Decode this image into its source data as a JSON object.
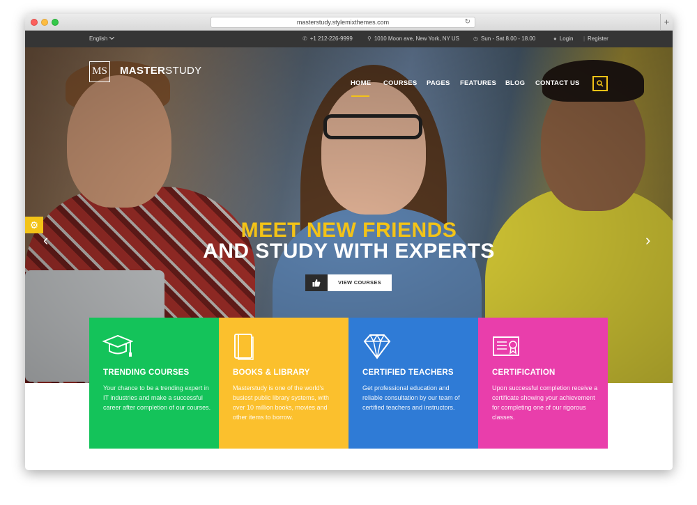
{
  "browser": {
    "url": "masterstudy.stylemixthemes.com",
    "new_tab_label": "+"
  },
  "topbar": {
    "language": "English",
    "phone": "+1 212-226-9999",
    "address": "1010 Moon ave, New York, NY US",
    "hours": "Sun - Sat 8.00 - 18.00",
    "login": "Login",
    "separator": "|",
    "register": "Register"
  },
  "logo": {
    "mark": "MS",
    "name_bold": "MASTER",
    "name_light": "STUDY"
  },
  "nav": {
    "items": [
      "HOME",
      "COURSES",
      "PAGES",
      "FEATURES",
      "BLOG",
      "CONTACT US"
    ],
    "active": "HOME"
  },
  "hero": {
    "headline_1": "MEET NEW FRIENDS",
    "headline_2": "AND STUDY WITH EXPERTS",
    "cta_label": "VIEW COURSES",
    "cta_icon": "thumbs-up-icon",
    "prev_arrow": "‹",
    "next_arrow": "›"
  },
  "features": [
    {
      "title": "TRENDING COURSES",
      "text": "Your chance to be a trending expert in IT industries and make a successful career after completion of our courses.",
      "icon": "graduation-cap-icon",
      "color": "#14c35a"
    },
    {
      "title": "BOOKS & LIBRARY",
      "text": "Masterstudy is one of the world's busiest public library systems, with over 10 million books, movies and other items to borrow.",
      "icon": "book-icon",
      "color": "#fbc02d"
    },
    {
      "title": "CERTIFIED TEACHERS",
      "text": "Get professional education and reliable consultation by our team of certified teachers and instructors.",
      "icon": "diamond-icon",
      "color": "#2f7bd6"
    },
    {
      "title": "CERTIFICATION",
      "text": "Upon successful completion receive a certificate showing your achievement for completing one of our rigorous classes.",
      "icon": "certificate-icon",
      "color": "#e93eab"
    }
  ],
  "colors": {
    "accent": "#f3c317",
    "topbar_bg": "#353535"
  }
}
